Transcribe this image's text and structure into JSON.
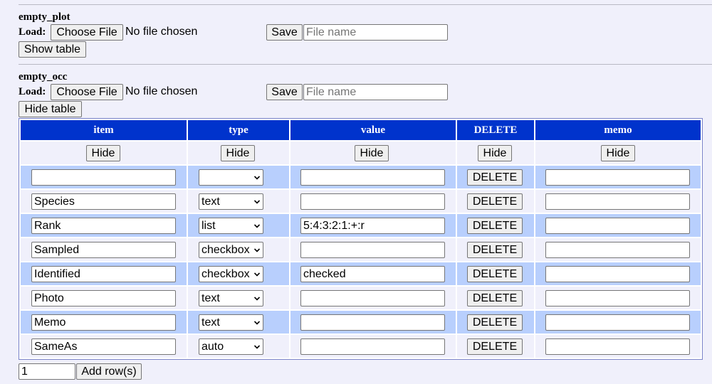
{
  "sections": [
    {
      "name": "empty_plot",
      "load_label": "Load:",
      "choose_label": "Choose File",
      "no_file_text": "No file chosen",
      "save_label": "Save",
      "filename_placeholder": "File name",
      "toggle_label": "Show table"
    },
    {
      "name": "empty_occ",
      "load_label": "Load:",
      "choose_label": "Choose File",
      "no_file_text": "No file chosen",
      "save_label": "Save",
      "filename_placeholder": "File name",
      "toggle_label": "Hide table"
    }
  ],
  "table": {
    "columns": [
      "item",
      "type",
      "value",
      "DELETE",
      "memo"
    ],
    "hide_label": "Hide",
    "delete_label": "DELETE",
    "header_color": "#0033cc",
    "stripe_color": "#b8cffd",
    "rows": [
      {
        "item": "",
        "type": "",
        "value": "",
        "memo": ""
      },
      {
        "item": "Species",
        "type": "text",
        "value": "",
        "memo": ""
      },
      {
        "item": "Rank",
        "type": "list",
        "value": "5:4:3:2:1:+:r",
        "memo": ""
      },
      {
        "item": "Sampled",
        "type": "checkbox",
        "value": "",
        "memo": ""
      },
      {
        "item": "Identified",
        "type": "checkbox",
        "value": "checked",
        "memo": ""
      },
      {
        "item": "Photo",
        "type": "text",
        "value": "",
        "memo": ""
      },
      {
        "item": "Memo",
        "type": "text",
        "value": "",
        "memo": ""
      },
      {
        "item": "SameAs",
        "type": "auto",
        "value": "",
        "memo": ""
      }
    ]
  },
  "add_rows": {
    "count_value": "1",
    "button_label": "Add row(s)"
  }
}
